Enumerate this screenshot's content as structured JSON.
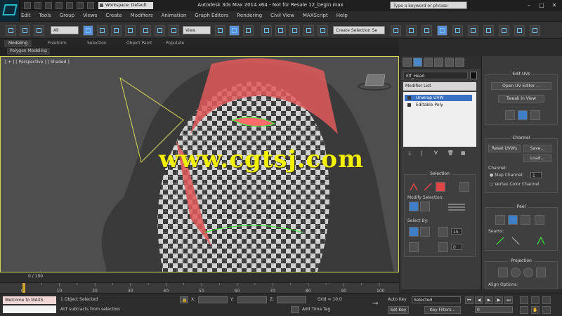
{
  "app": {
    "window_title": "Autodesk 3ds Max  2014 x64  -  Not for Resale    12_begin.max",
    "workspace": "Workspace: Default",
    "search_placeholder": "Type a keyword or phrase",
    "accent_color": "#4b89c6"
  },
  "menu": [
    "Edit",
    "Tools",
    "Group",
    "Views",
    "Create",
    "Modifiers",
    "Animation",
    "Graph Editors",
    "Rendering",
    "Civil View",
    "MAXScript",
    "Help"
  ],
  "toolbar": {
    "selection_filter": "All",
    "reference_coord": "View",
    "named_selection": "Create Selection Se"
  },
  "ribbon": {
    "tabs": [
      "Modeling",
      "Freeform",
      "Selection",
      "Object Paint",
      "Populate"
    ],
    "sub_label": "Polygon Modeling"
  },
  "viewport": {
    "label": "[ + ] [ Perspective ] [ Shaded ]",
    "watermark": "www.cgtsj.com"
  },
  "command_panel": {
    "object_name": "Elf_Head",
    "modifier_list": "Modifier List",
    "stack": [
      "Unwrap UVW",
      "Editable Poly"
    ],
    "selection_title": "Selection",
    "modify_selection": "Modify Selection:",
    "select_by": "Select By:",
    "spin_a": "15",
    "spin_b": "0"
  },
  "edit_panel": {
    "edit_uvs_title": "Edit UVs",
    "open_uv_editor": "Open UV Editor ...",
    "tweak_in_view": "Tweak In View",
    "channel_title": "Channel",
    "reset_uvws": "Reset UVWs",
    "save": "Save...",
    "load": "Load...",
    "channel_label": "Channel:",
    "map_channel": "Map Channel:",
    "map_channel_value": "1",
    "vertex_color_channel": "Vertex Color Channel",
    "peel_title": "Peel",
    "seams_label": "Seams:",
    "projection_title": "Projection",
    "align_options": "Align Options:"
  },
  "timeline": {
    "frame": "0 / 100",
    "ticks": [
      "0",
      "10",
      "20",
      "30",
      "40",
      "50",
      "60",
      "70",
      "80",
      "90",
      "100"
    ]
  },
  "status": {
    "maxscript_text": "Welcome to MAXS",
    "selected": "1 Object Selected",
    "prompt": "ALT subtracts from selection",
    "x_label": "X:",
    "y_label": "Y:",
    "z_label": "Z:",
    "grid": "Grid = 10.0",
    "add_time_tag": "Add Time Tag",
    "auto_key": "Auto Key",
    "set_key": "Set Key",
    "selected_filter": "Selected",
    "key_filters": "Key Filters...",
    "frame_value": "0"
  }
}
